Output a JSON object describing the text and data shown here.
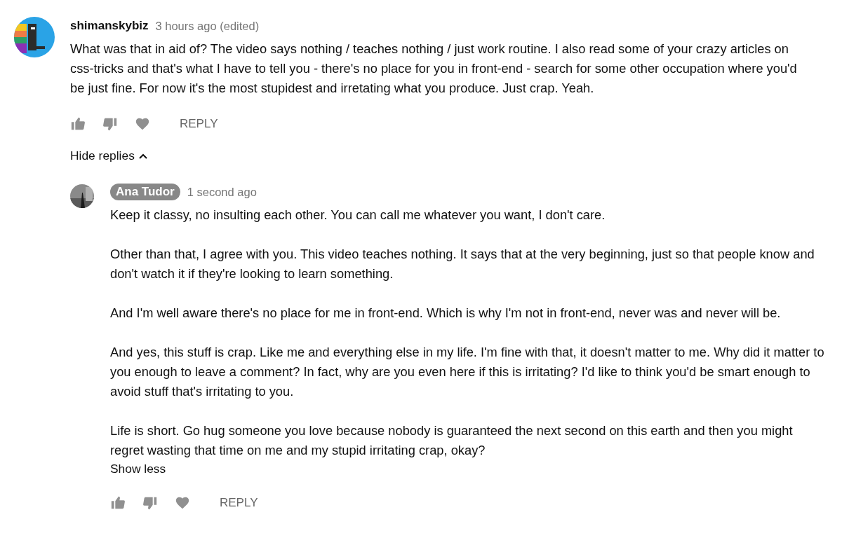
{
  "comment": {
    "author": "shimanskybiz",
    "author_is_owner": false,
    "time": "3 hours ago (edited)",
    "paragraphs": [
      "What was that in aid of? The video says nothing / teaches nothing / just work routine. I also read some of your crazy articles on css-tricks and that's what I have to tell you - there's no place for you in front-end - search for some other occupation where you'd be just fine. For now it's the most stupidest and irretating what you produce. Just crap. Yeah."
    ],
    "reply_button": "REPLY"
  },
  "toggle": {
    "label": "Hide replies",
    "expanded": true
  },
  "replies": [
    {
      "author": "Ana Tudor",
      "author_is_owner": true,
      "time": "1 second ago",
      "paragraphs": [
        "Keep it classy, no insulting each other. You can call me whatever you want, I don't care.",
        "Other than that, I agree with you. This video teaches nothing. It says that at the very beginning, just so that people know and don't watch it if they're looking to learn something.",
        "And I'm well aware there's no place for me in front-end. Which is why I'm not in front-end, never was and never will be.",
        "And yes, this stuff is crap. Like me and everything else in my life. I'm fine with that, it doesn't matter to me. Why did it matter to you enough to leave a comment? In fact, why are you even here if this is irritating? I'd like to think you'd be smart enough to avoid stuff that's irritating to you.",
        "Life is short. Go hug someone you love because nobody is guaranteed the next second on this earth and then you might regret wasting that time on me and my stupid irritating crap, okay?"
      ],
      "show_less": "Show less",
      "reply_button": "REPLY"
    }
  ]
}
